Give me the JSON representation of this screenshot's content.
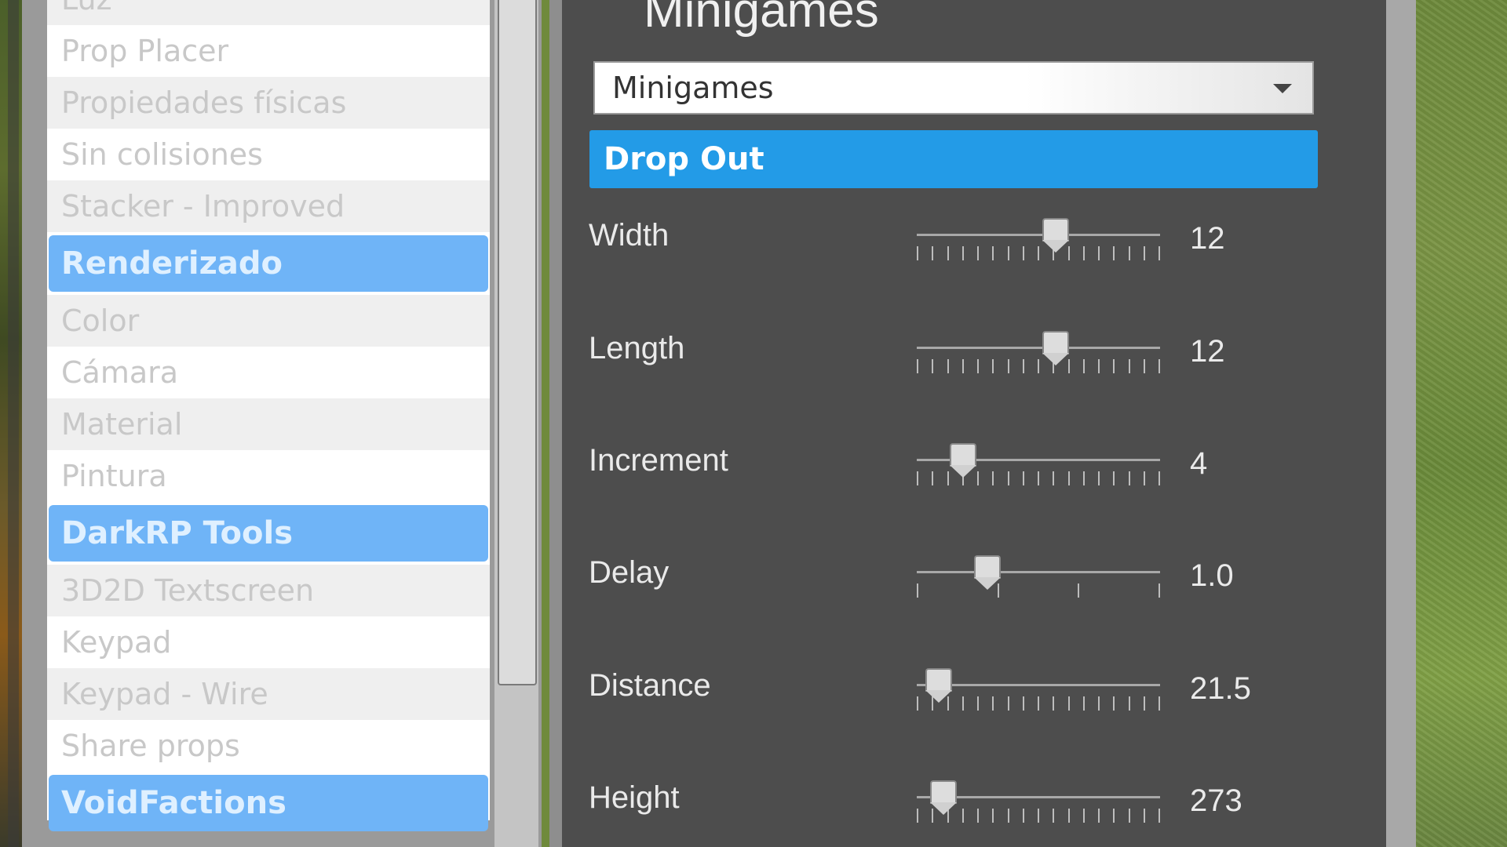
{
  "left_panel": {
    "items": [
      {
        "label": "Luz",
        "type": "item"
      },
      {
        "label": "Prop Placer",
        "type": "item"
      },
      {
        "label": "Propiedades físicas",
        "type": "item"
      },
      {
        "label": "Sin colisiones",
        "type": "item"
      },
      {
        "label": "Stacker - Improved",
        "type": "item"
      },
      {
        "label": "Renderizado",
        "type": "category"
      },
      {
        "label": "Color",
        "type": "item"
      },
      {
        "label": "Cámara",
        "type": "item"
      },
      {
        "label": "Material",
        "type": "item"
      },
      {
        "label": "Pintura",
        "type": "item"
      },
      {
        "label": "DarkRP Tools",
        "type": "category"
      },
      {
        "label": "3D2D Textscreen",
        "type": "item"
      },
      {
        "label": "Keypad",
        "type": "item"
      },
      {
        "label": "Keypad - Wire",
        "type": "item"
      },
      {
        "label": "Share props",
        "type": "item"
      },
      {
        "label": "VoidFactions",
        "type": "category"
      }
    ]
  },
  "right_panel": {
    "title": "Minigames",
    "dropdown": {
      "selected": "Minigames"
    },
    "section_title": "Drop Out",
    "sliders": [
      {
        "label": "Width",
        "value_text": "12",
        "fraction": 0.57,
        "tick_count": 17
      },
      {
        "label": "Length",
        "value_text": "12",
        "fraction": 0.57,
        "tick_count": 17
      },
      {
        "label": "Increment",
        "value_text": "4",
        "fraction": 0.19,
        "tick_count": 17
      },
      {
        "label": "Delay",
        "value_text": "1.0",
        "fraction": 0.29,
        "tick_count": 4
      },
      {
        "label": "Distance",
        "value_text": "21.5",
        "fraction": 0.09,
        "tick_count": 17
      },
      {
        "label": "Height",
        "value_text": "273",
        "fraction": 0.11,
        "tick_count": 17
      }
    ]
  },
  "colors": {
    "category_bg": "#6fb4f7",
    "section_header_bg": "#239be7",
    "panel_bg": "#4d4d4d"
  },
  "icons": {
    "dropdown_arrow": "caret-down-icon"
  }
}
